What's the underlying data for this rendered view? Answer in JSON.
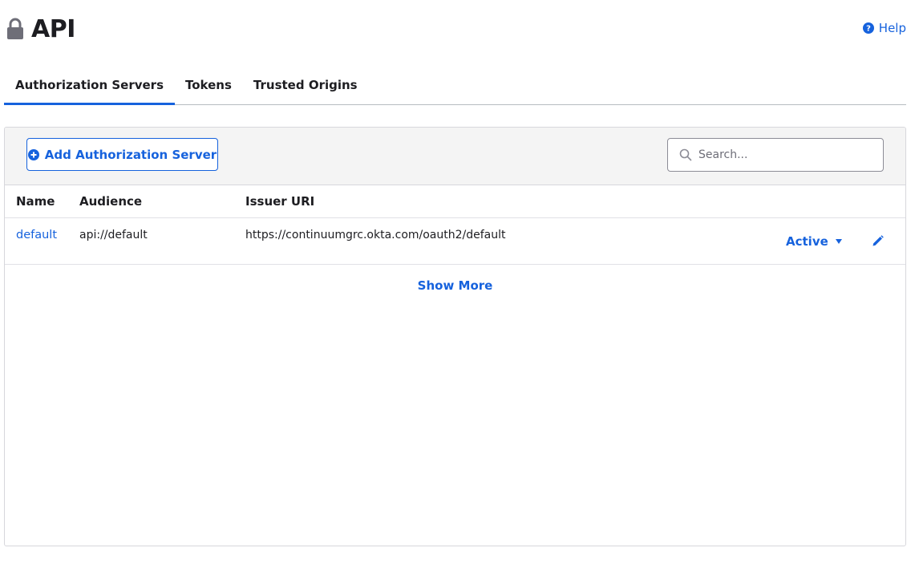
{
  "page": {
    "title": "API",
    "help_label": "Help"
  },
  "tabs": [
    {
      "label": "Authorization Servers",
      "active": true
    },
    {
      "label": "Tokens",
      "active": false
    },
    {
      "label": "Trusted Origins",
      "active": false
    }
  ],
  "toolbar": {
    "add_label": "Add Authorization Server",
    "search_placeholder": "Search...",
    "search_value": ""
  },
  "table": {
    "headers": {
      "name": "Name",
      "audience": "Audience",
      "issuer": "Issuer URI"
    },
    "rows": [
      {
        "name": "default",
        "audience": "api://default",
        "issuer": "https://continuumgrc.okta.com/oauth2/default",
        "status": "Active"
      }
    ],
    "show_more_label": "Show More"
  },
  "icons": {
    "lock": "lock-icon",
    "help": "help-icon",
    "plus": "plus-circle-icon",
    "search": "search-icon",
    "caret": "caret-down-icon",
    "edit": "pencil-icon"
  },
  "colors": {
    "accent": "#1662dd",
    "text": "#1d1d21",
    "toolbar_bg": "#f4f4f4",
    "border": "#d7d7dc"
  }
}
